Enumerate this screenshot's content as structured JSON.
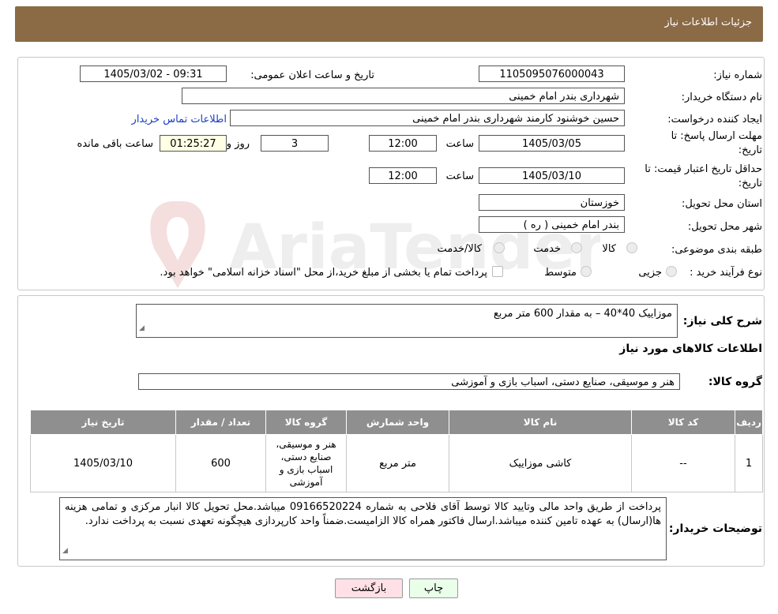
{
  "header": {
    "title": "جزئیات اطلاعات نیاز"
  },
  "labels": {
    "need_number": "شماره نیاز:",
    "announce_datetime": "تاریخ و ساعت اعلان عمومی:",
    "buyer_org": "نام دستگاه خریدار:",
    "requester": "ایجاد کننده درخواست:",
    "contact_link": "اطلاعات تماس خریدار",
    "reply_deadline_line1": "مهلت ارسال پاسخ: تا",
    "reply_deadline_line2": "تاریخ:",
    "time_word": "ساعت",
    "day_and": "روز و",
    "remaining": "ساعت باقی مانده",
    "price_validity_line1": "حداقل تاریخ اعتبار قیمت: تا",
    "price_validity_line2": "تاریخ:",
    "province": "استان محل تحویل:",
    "city": "شهر محل تحویل:",
    "category": "طبقه بندی موضوعی:",
    "process_type": "نوع فرآیند خرید :",
    "general_desc": "شرح کلی نیاز:",
    "items_info": "اطلاعات کالاهای مورد نیاز",
    "goods_group": "گروه کالا:",
    "buyer_notes": "توضیحات خریدار:"
  },
  "values": {
    "need_number": "1105095076000043",
    "announce_datetime": "1405/03/02 - 09:31",
    "buyer_org": "شهرداری بندر امام خمینی",
    "requester": "حسین خوشنود کارمند شهرداری بندر امام خمینی",
    "reply_date": "1405/03/05",
    "reply_time": "12:00",
    "days": "3",
    "remaining_time": "01:25:27",
    "validity_date": "1405/03/10",
    "validity_time": "12:00",
    "province": "خوزستان",
    "city": "بندر امام خمینی ( ره )",
    "general_desc": "موزاییک 40*40 – به مقدار  600 متر مربع",
    "goods_group": "هنر و موسیقی، صنایع دستی، اسباب بازی و آموزشی",
    "buyer_notes": "پرداخت از طریق واحد مالی وتایید کالا توسط آقای فلاحی به شماره 09166520224 میباشد.محل تحویل کالا انبار مرکزی و تمامی هزینه ها(ارسال) به عهده تامین کننده میباشد.ارسال فاکتور همراه کالا الزامیست.ضمناً واحد کارپردازی هیچگونه تعهدی نسبت به پرداخت ندارد."
  },
  "category_options": [
    "کالا",
    "خدمت",
    "کالا/خدمت"
  ],
  "process_options": [
    "جزیی",
    "متوسط"
  ],
  "process_note": "پرداخت تمام یا بخشی از مبلغ خرید،از محل \"اسناد خزانه اسلامی\" خواهد بود.",
  "table": {
    "headers": [
      "ردیف",
      "کد کالا",
      "نام کالا",
      "واحد شمارش",
      "گروه کالا",
      "تعداد / مقدار",
      "تاریخ نیاز"
    ],
    "rows": [
      [
        "1",
        "--",
        "کاشی موزاییک",
        "متر مربع",
        "هنر و موسیقی، صنایع دستی، اسباب بازی و آموزشی",
        "600",
        "1405/03/10"
      ]
    ]
  },
  "buttons": {
    "back": "بازگشت",
    "print": "چاپ"
  },
  "watermark": "AriaTender.neT",
  "colors": {
    "header_bg": "#8b6a46",
    "table_header_bg": "#8f8f8f",
    "back_button_bg": "#ffe0e6",
    "print_button_bg": "#eaffea",
    "link": "#1a3fbf"
  }
}
